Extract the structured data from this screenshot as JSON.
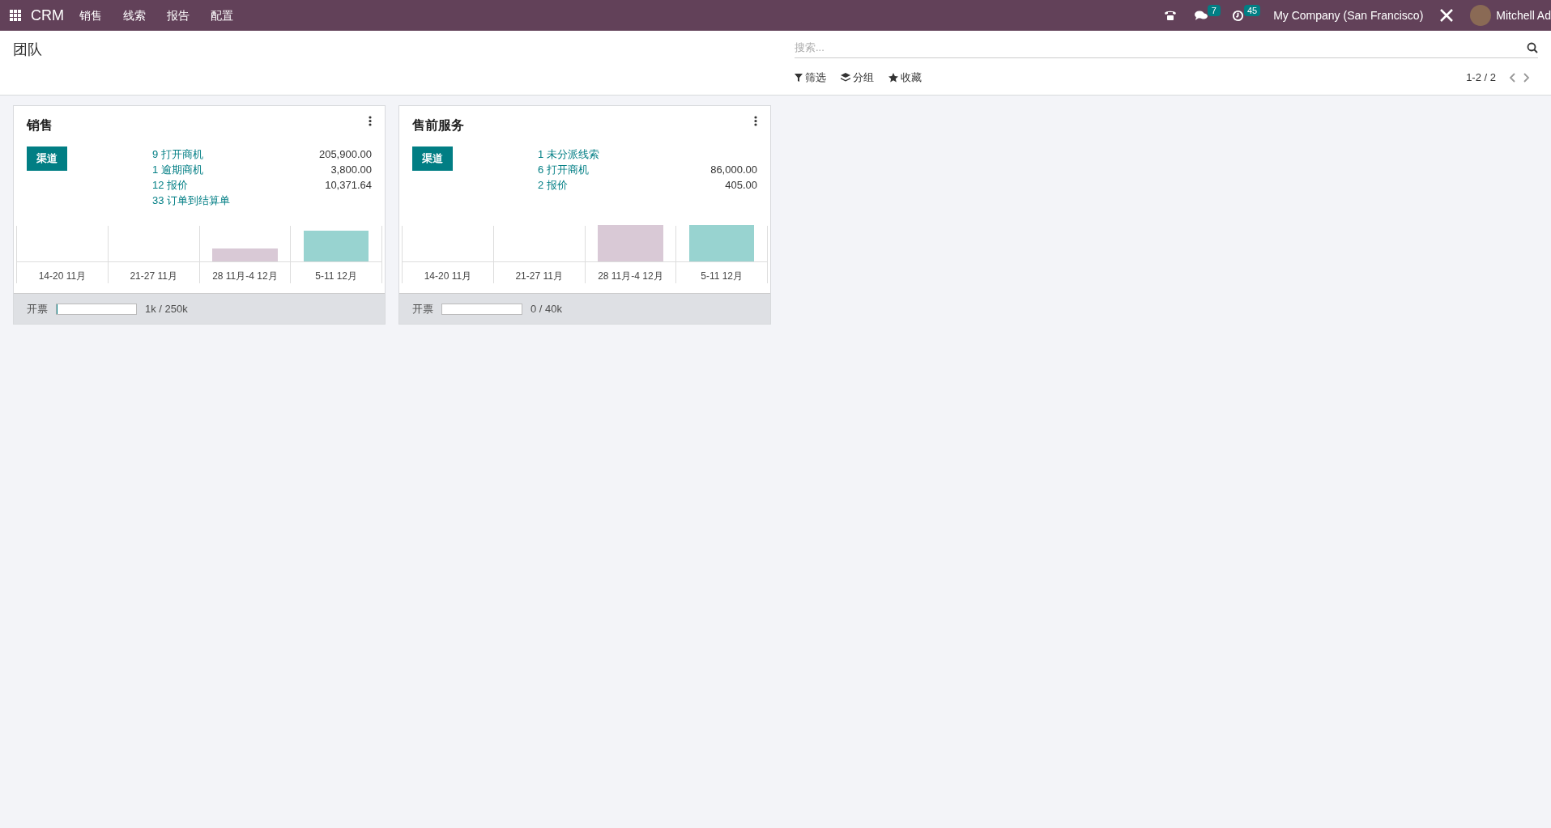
{
  "navbar": {
    "app": "CRM",
    "menu": [
      "销售",
      "线索",
      "报告",
      "配置"
    ],
    "messages_count": "7",
    "activities_count": "45",
    "company": "My Company (San Francisco)",
    "user": "Mitchell Ad"
  },
  "control_panel": {
    "title": "团队",
    "search": {
      "placeholder": "搜索..."
    },
    "filters": [
      "筛选",
      "分组",
      "收藏"
    ],
    "pager": "1-2 / 2"
  },
  "cards": [
    {
      "title": "销售",
      "pipeline_button": "渠道",
      "stats": [
        {
          "label": "9 打开商机",
          "amount": "205,900.00"
        },
        {
          "label": "1 逾期商机",
          "amount": "3,800.00"
        },
        {
          "label": "12 报价",
          "amount": "10,371.64"
        },
        {
          "label": "33 订单到结算单"
        }
      ],
      "weeks": [
        "14-20 11月",
        "21-27 11月",
        "28 11月-4 12月",
        "5-11 12月"
      ],
      "invoicing": {
        "label": "开票",
        "level": 0.004,
        "reading": "1k / 250k"
      }
    },
    {
      "title": "售前服务",
      "pipeline_button": "渠道",
      "stats": [
        {
          "label": "1 未分派线索"
        },
        {
          "label": "6 打开商机",
          "amount": "86,000.00"
        },
        {
          "label": "2 报价",
          "amount": "405.00"
        }
      ],
      "weeks": [
        "14-20 11月",
        "21-27 11月",
        "28 11月-4 12月",
        "5-11 12月"
      ],
      "invoicing": {
        "label": "开票",
        "level": 0,
        "reading": "0 / 40k"
      }
    }
  ]
}
